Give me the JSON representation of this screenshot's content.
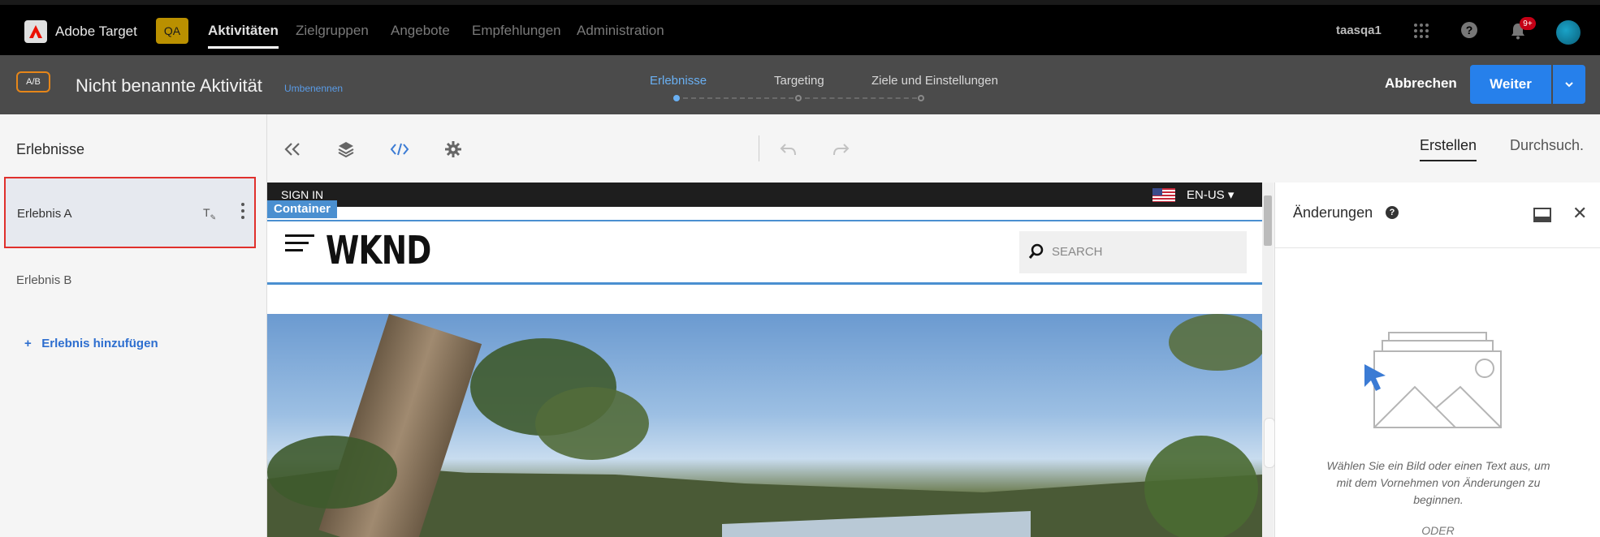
{
  "topnav": {
    "brand": "Adobe Target",
    "env_badge": "QA",
    "items": [
      {
        "label": "Aktivitäten",
        "active": true
      },
      {
        "label": "Zielgruppen",
        "active": false
      },
      {
        "label": "Angebote",
        "active": false
      },
      {
        "label": "Empfehlungen",
        "active": false
      },
      {
        "label": "Administration",
        "active": false
      }
    ],
    "user": "taasqa1",
    "notifications_badge": "9+",
    "icons": [
      "apps-icon",
      "help-icon",
      "bell-icon",
      "avatar"
    ]
  },
  "activity": {
    "type_badge": "A/B",
    "title": "Nicht benannte Aktivität",
    "rename_link": "Umbenennen",
    "steps": [
      {
        "label": "Erlebnisse",
        "active": true
      },
      {
        "label": "Targeting",
        "active": false
      },
      {
        "label": "Ziele und Einstellungen",
        "active": false
      }
    ],
    "cancel_label": "Abbrechen",
    "next_label": "Weiter"
  },
  "sidebar": {
    "title": "Erlebnisse",
    "experiences": [
      {
        "label": "Erlebnis A",
        "selected": true
      },
      {
        "label": "Erlebnis B",
        "selected": false
      }
    ],
    "add_label": "Erlebnis hinzufügen"
  },
  "toolbar": {
    "icons": [
      "collapse-left-icon",
      "layers-icon",
      "code-icon",
      "gear-icon",
      "undo-icon",
      "redo-icon"
    ],
    "tabs": [
      {
        "label": "Erstellen",
        "active": true
      },
      {
        "label": "Durchsuch.",
        "active": false
      }
    ]
  },
  "site": {
    "sign_in": "SIGN IN",
    "language": "EN-US",
    "container_tag": "Container",
    "logo": "WKND",
    "search_placeholder": "SEARCH"
  },
  "changes_panel": {
    "title": "Änderungen",
    "hint": "Wählen Sie ein Bild oder einen Text aus, um mit dem Vornehmen von Änderungen zu beginnen.",
    "or_label": "ODER"
  },
  "colors": {
    "accent": "#2680eb",
    "active_step": "#6ab0f3",
    "selection_border": "#e0302c",
    "ab_badge": "#e68619",
    "qa_badge": "#ba9000"
  }
}
